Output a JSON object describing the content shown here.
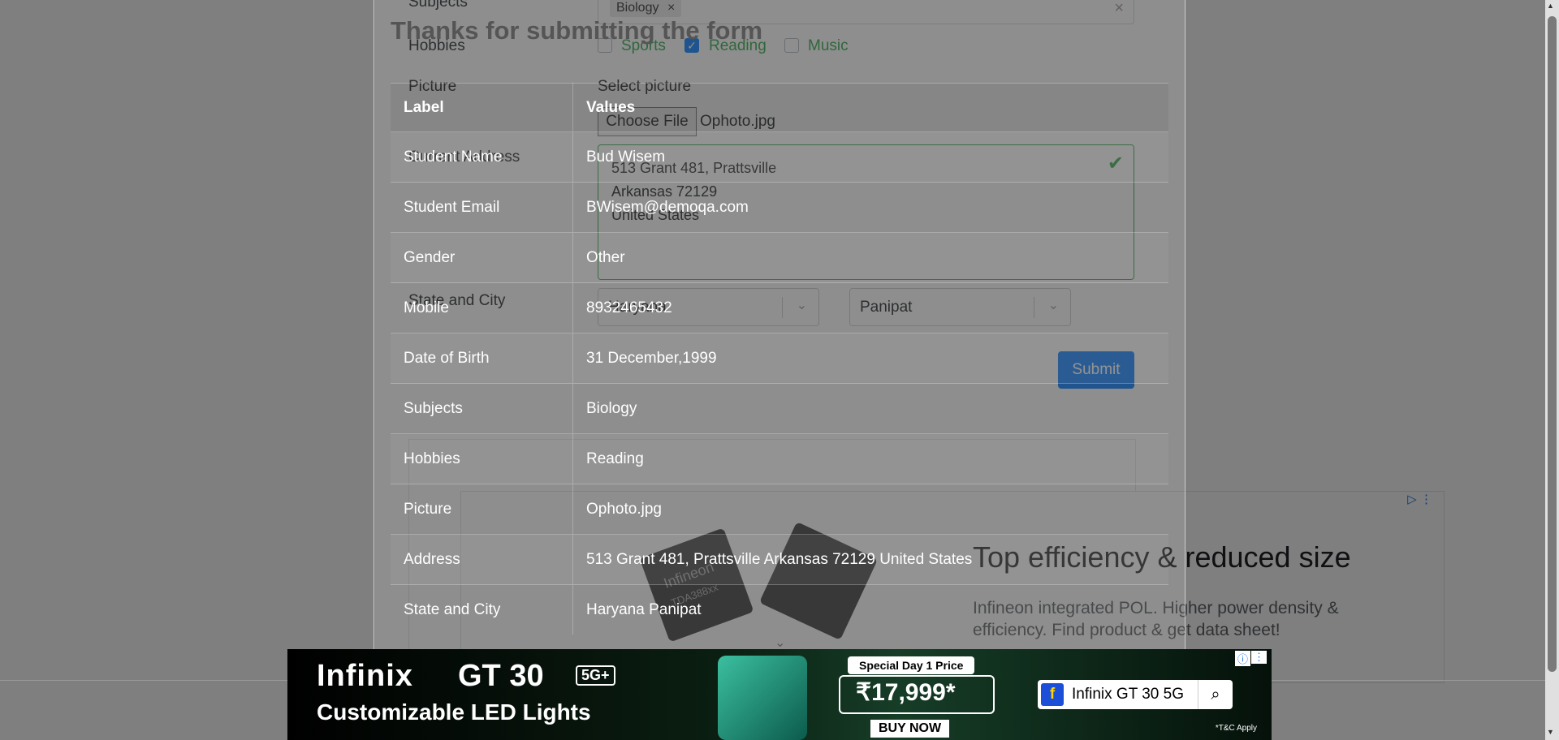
{
  "form": {
    "subjects_label": "Subjects",
    "subject_chip": "Biology",
    "chip_remove": "×",
    "subjects_clear": "×",
    "hobbies_label": "Hobbies",
    "hobby_sports": "Sports",
    "hobby_reading": "Reading",
    "hobby_music": "Music",
    "reading_checked": true,
    "picture_label": "Picture",
    "picture_prompt": "Select picture",
    "choose_file_label": "Choose File",
    "file_name": "Ophoto.jpg",
    "address_label": "Current Address",
    "address_lines": [
      "513 Grant 481, Prattsville",
      "Arkansas 72129",
      "United States"
    ],
    "state_city_label": "State and City",
    "state_value": "Haryana",
    "city_value": "Panipat",
    "submit_label": "Submit"
  },
  "modal": {
    "title": "Thanks for submitting the form",
    "header_label": "Label",
    "header_values": "Values",
    "rows": [
      {
        "label": "Student Name",
        "value": "Bud Wisem"
      },
      {
        "label": "Student Email",
        "value": "BWisem@demoqa.com"
      },
      {
        "label": "Gender",
        "value": "Other"
      },
      {
        "label": "Mobile",
        "value": "8932465432"
      },
      {
        "label": "Date of Birth",
        "value": "31 December,1999"
      },
      {
        "label": "Subjects",
        "value": "Biology"
      },
      {
        "label": "Hobbies",
        "value": "Reading"
      },
      {
        "label": "Picture",
        "value": "Ophoto.jpg"
      },
      {
        "label": "Address",
        "value": "513 Grant 481, Prattsville Arkansas 72129 United States"
      },
      {
        "label": "State and City",
        "value": "Haryana Panipat"
      }
    ]
  },
  "ad": {
    "headline": "Top efficiency & reduced size",
    "description": "Infineon integrated POL. Higher power density & efficiency. Find product & get data sheet!",
    "chip_text_1": "Infineon",
    "chip_text_2": "TDA388xx",
    "choices_icon": "adchoices-icon"
  },
  "banner": {
    "brand": "Infinix",
    "model": "GT 30",
    "badge": "5G+",
    "tagline": "Customizable LED Lights",
    "special": "Special Day 1 Price",
    "price": "₹17,999*",
    "buy": "BUY NOW",
    "search_text": "Infinix GT 30 5G",
    "tc": "*T&C Apply"
  },
  "colors": {
    "accent": "#007bff",
    "checkbox_label": "#28a745",
    "backdrop": "rgba(0,0,0,0.5)"
  }
}
